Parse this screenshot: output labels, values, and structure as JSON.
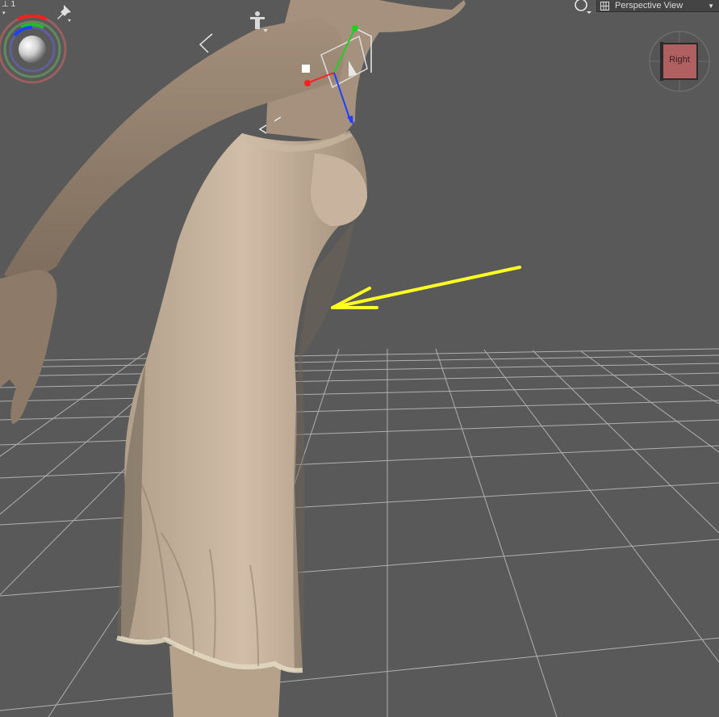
{
  "viewport": {
    "camera_index": "1",
    "view_name": "Perspective View",
    "cube_face": "Right"
  },
  "icons": {
    "camera_tools": [
      "orbit-icon",
      "pin-icon",
      "figure-select-icon",
      "camera-selector-icon"
    ],
    "view": [
      "light-bulb-icon",
      "view-layout-icon",
      "chevron-down-icon"
    ]
  },
  "colors": {
    "background": "#595959",
    "grid": "#cfcfcf",
    "annotation_arrow": "#ffff22",
    "axis_x": "#ff2020",
    "axis_y": "#20d020",
    "axis_z": "#2040ff",
    "skin": "#b8a48e",
    "dress": "#a89478"
  }
}
